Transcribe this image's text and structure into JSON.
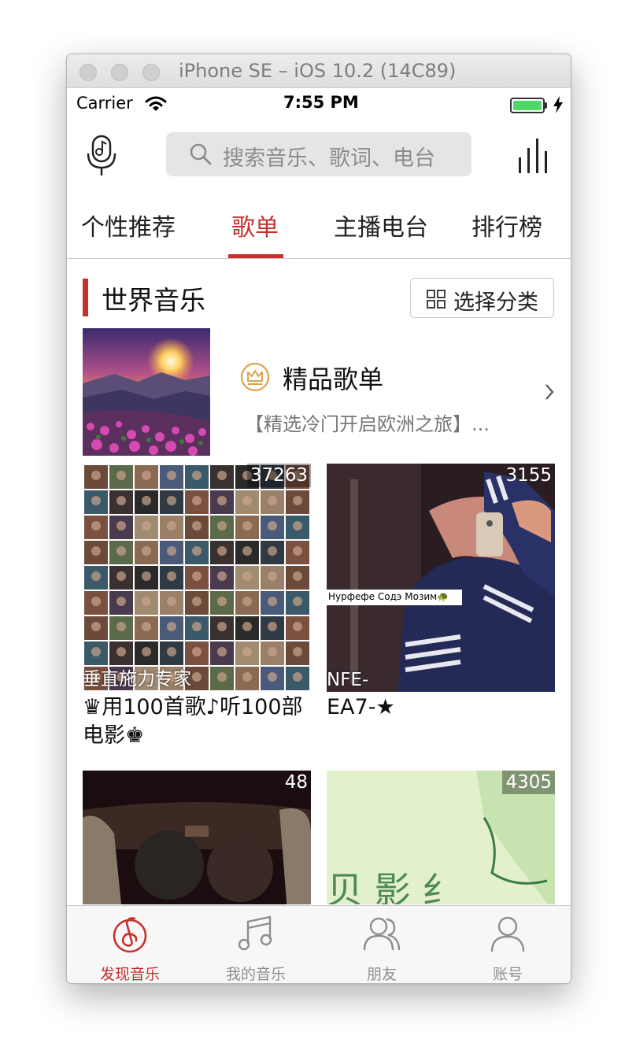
{
  "window": {
    "title": "iPhone SE – iOS 10.2 (14C89)"
  },
  "status_bar": {
    "carrier": "Carrier",
    "time": "7:55 PM",
    "battery_level": 1.0,
    "battery_color": "#4cd964"
  },
  "search": {
    "placeholder": "搜索音乐、歌词、电台"
  },
  "tabs": [
    {
      "label": "个性推荐",
      "active": false
    },
    {
      "label": "歌单",
      "active": true
    },
    {
      "label": "主播电台",
      "active": false
    },
    {
      "label": "排行榜",
      "active": false
    }
  ],
  "section": {
    "title": "世界音乐",
    "category_button": "选择分类"
  },
  "featured": {
    "title": "精品歌单",
    "subtitle": "【精选冷门开启欧洲之旅】..."
  },
  "playlists": [
    {
      "count": "37263",
      "overlay": "垂直施力专家",
      "title": "♛用100首歌♪听100部电影♚"
    },
    {
      "count": "3155",
      "overlay": "NFE-",
      "sticker": "Нурфефе Содэ Мозим🐢",
      "title": "EA7-★"
    },
    {
      "count": "48",
      "overlay": "",
      "title": ""
    },
    {
      "count": "4305",
      "overlay": "",
      "title": ""
    }
  ],
  "tab_bar": [
    {
      "label": "发现音乐",
      "icon": "netease-music-icon",
      "active": true
    },
    {
      "label": "我的音乐",
      "icon": "music-note-icon",
      "active": false
    },
    {
      "label": "朋友",
      "icon": "friends-icon",
      "active": false
    },
    {
      "label": "账号",
      "icon": "account-icon",
      "active": false
    }
  ],
  "colors": {
    "accent": "#c6302d",
    "tab_inactive": "#8e8e8e",
    "search_bg": "#e4e5e7"
  }
}
